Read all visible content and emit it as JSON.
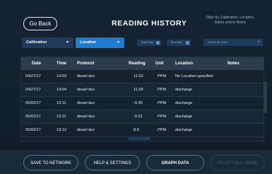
{
  "header": {
    "back_label": "Go Back",
    "title": "READING HISTORY",
    "hint": "Filter by Calibration, Location, Dates and/or Notes"
  },
  "filters": {
    "calibration": {
      "label": "Calibration"
    },
    "location": {
      "label": "Location"
    },
    "start_date_placeholder": "Start Date",
    "end_date_placeholder": "End Date",
    "search_placeholder": "Search for notes"
  },
  "table": {
    "headers": [
      "Date",
      "Time",
      "Protocol",
      "Reading",
      "Unit",
      "Location",
      "Notes"
    ],
    "rows": [
      {
        "date": "04/27/17",
        "time": "14:03",
        "protocol": "diesel duv",
        "reading": "11.52",
        "unit": "PPM",
        "location": "No Location specified",
        "notes": ""
      },
      {
        "date": "04/27/17",
        "time": "14:04",
        "protocol": "diesel duv",
        "reading": "11.69",
        "unit": "PPM",
        "location": "discharge",
        "notes": ""
      },
      {
        "date": "05/02/17",
        "time": "13:11",
        "protocol": "diesel duv",
        "reading": "-0.35",
        "unit": "PPM",
        "location": "discharge",
        "notes": ""
      },
      {
        "date": "05/02/17",
        "time": "13:11",
        "protocol": "diesel duv",
        "reading": "-0.31",
        "unit": "PPM",
        "location": "discharge",
        "notes": ""
      },
      {
        "date": "05/02/17",
        "time": "13:12",
        "protocol": "diesel duv",
        "reading": "8.9",
        "unit": "PPM",
        "location": "discharge",
        "notes": ""
      }
    ]
  },
  "footer": {
    "save": "SAVE TO NETWORK",
    "help": "HELP & SETTINGS",
    "graph": "GRAPH DATA",
    "select_all": "SELECT ALL / NONE"
  },
  "colors": {
    "background": "#101c2a",
    "accent": "#1f7ad1",
    "highlight": "#1f6fb9"
  }
}
